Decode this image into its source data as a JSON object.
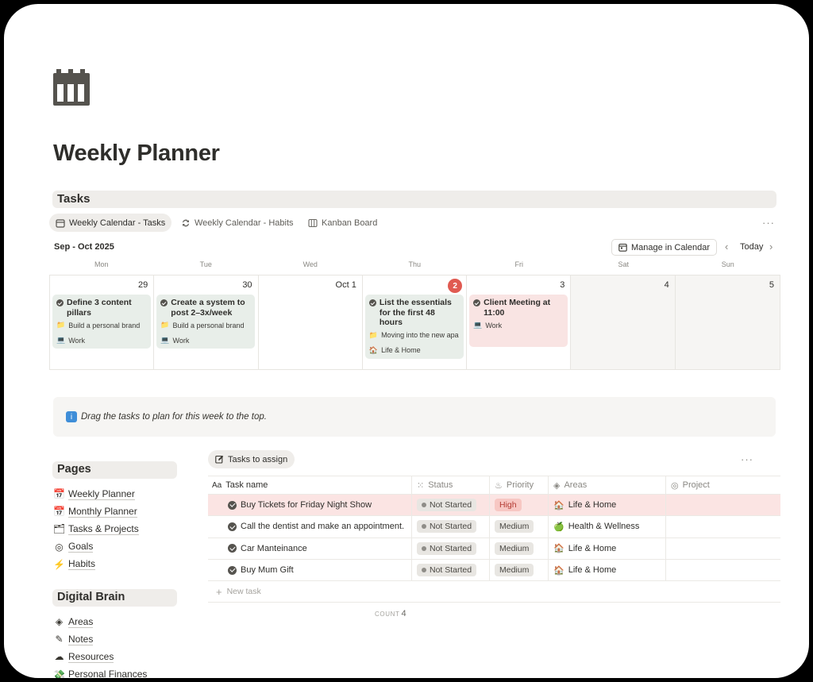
{
  "page": {
    "title": "Weekly Planner",
    "icon": "calendar-icon"
  },
  "tasks_section": {
    "title": "Tasks"
  },
  "view_tabs": [
    {
      "label": "Weekly Calendar - Tasks",
      "icon": "calendar-icon",
      "active": true
    },
    {
      "label": "Weekly Calendar - Habits",
      "icon": "repeat-icon",
      "active": false
    },
    {
      "label": "Kanban Board",
      "icon": "board-icon",
      "active": false
    }
  ],
  "more_label": "···",
  "calendar": {
    "month_label": "Sep - Oct 2025",
    "manage_label": "Manage in Calendar",
    "today_label": "Today",
    "prev_icon": "chevron-left-icon",
    "next_icon": "chevron-right-icon",
    "weekdays": [
      "Mon",
      "Tue",
      "Wed",
      "Thu",
      "Fri",
      "Sat",
      "Sun"
    ],
    "days": [
      {
        "date": "29"
      },
      {
        "date": "30"
      },
      {
        "date": "Oct 1"
      },
      {
        "date": "2",
        "today": true
      },
      {
        "date": "3"
      },
      {
        "date": "4"
      },
      {
        "date": "5"
      }
    ],
    "cards": [
      {
        "title": "Define 3 content pillars",
        "project": "Build a personal brand",
        "area": "Work"
      },
      {
        "title": "Create a system to post 2–3x/week",
        "project": "Build a personal brand",
        "area": "Work"
      },
      {
        "title": "List the essentials for the first 48 hours",
        "project": "Moving into the new apa",
        "area": "Life & Home"
      },
      {
        "title": "Client Meeting at 11:00",
        "area": "Work"
      }
    ]
  },
  "callout": {
    "icon": "info-icon",
    "text": "Drag the tasks to plan for this week to the top."
  },
  "pages_section": {
    "title": "Pages",
    "items": [
      "Weekly Planner",
      "Monthly Planner",
      "Tasks & Projects",
      "Goals",
      "Habits"
    ]
  },
  "brain_section": {
    "title": "Digital Brain",
    "items": [
      "Areas",
      "Notes",
      "Resources",
      "Personal Finances"
    ]
  },
  "assign": {
    "tab_label": "Tasks to assign",
    "columns": [
      "Task name",
      "Status",
      "Priority",
      "Areas",
      "Project"
    ],
    "rows": [
      {
        "task": "Buy Tickets for Friday Night Show",
        "status": "Not Started",
        "priority": "High",
        "area": "Life & Home"
      },
      {
        "task": "Call the dentist and make an appointment.",
        "status": "Not Started",
        "priority": "Medium",
        "area": "Health & Wellness"
      },
      {
        "task": "Car Manteinance",
        "status": "Not Started",
        "priority": "Medium",
        "area": "Life & Home"
      },
      {
        "task": "Buy Mum Gift",
        "status": "Not Started",
        "priority": "Medium",
        "area": "Life & Home"
      }
    ],
    "new_task_label": "New task",
    "count_label": "COUNT",
    "count_value": "4"
  },
  "colors": {
    "today_badge": "#e05a51",
    "highlight_row": "#fbe4e3",
    "green_card": "#e8eee9",
    "pink_card": "#f9e4e3"
  }
}
